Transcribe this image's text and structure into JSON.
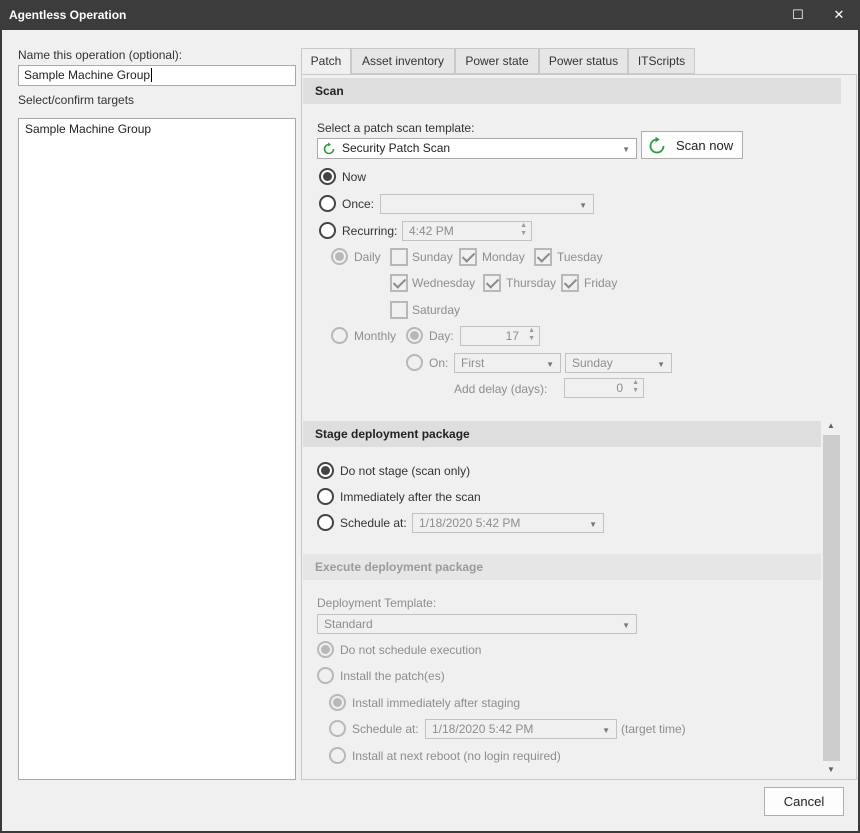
{
  "window": {
    "title": "Agentless Operation",
    "maximize_glyph": "☐",
    "close_glyph": "✕"
  },
  "left": {
    "name_label": "Name this operation (optional):",
    "name_value": "Sample Machine Group",
    "targets_label": "Select/confirm targets",
    "targets": [
      "Sample Machine Group"
    ]
  },
  "tabs": [
    "Patch",
    "Asset inventory",
    "Power state",
    "Power status",
    "ITScripts"
  ],
  "scan": {
    "header": "Scan",
    "template_label": "Select a patch scan template:",
    "template_value": "Security Patch Scan",
    "scan_now": "Scan now",
    "now": "Now",
    "once": "Once:",
    "recurring": "Recurring:",
    "recurring_time": "4:42 PM",
    "daily": "Daily",
    "days": {
      "sunday": "Sunday",
      "monday": "Monday",
      "tuesday": "Tuesday",
      "wednesday": "Wednesday",
      "thursday": "Thursday",
      "friday": "Friday",
      "saturday": "Saturday"
    },
    "monthly": "Monthly",
    "day_label": "Day:",
    "day_value": "17",
    "on_label": "On:",
    "on_ordinal": "First",
    "on_weekday": "Sunday",
    "delay_label": "Add delay (days):",
    "delay_value": "0"
  },
  "stage": {
    "header": "Stage deployment package",
    "do_not_stage": "Do not stage (scan only)",
    "immediately": "Immediately after the scan",
    "schedule_at": "Schedule at:",
    "schedule_value": "1/18/2020 5:42 PM"
  },
  "execute": {
    "header": "Execute deployment package",
    "template_label": "Deployment Template:",
    "template_value": "Standard",
    "do_not_schedule": "Do not schedule execution",
    "install": "Install the patch(es)",
    "install_immediately": "Install immediately after staging",
    "schedule_at": "Schedule at:",
    "schedule_value": "1/18/2020 5:42 PM",
    "target_time": "(target time)",
    "next_reboot": "Install at next reboot (no login required)"
  },
  "footer": {
    "cancel": "Cancel"
  },
  "colors": {
    "titlebar": "#3c3c3c",
    "client": "#f0f0f0",
    "section_header": "#dedede",
    "refresh_icon": "#2e9a3e"
  }
}
